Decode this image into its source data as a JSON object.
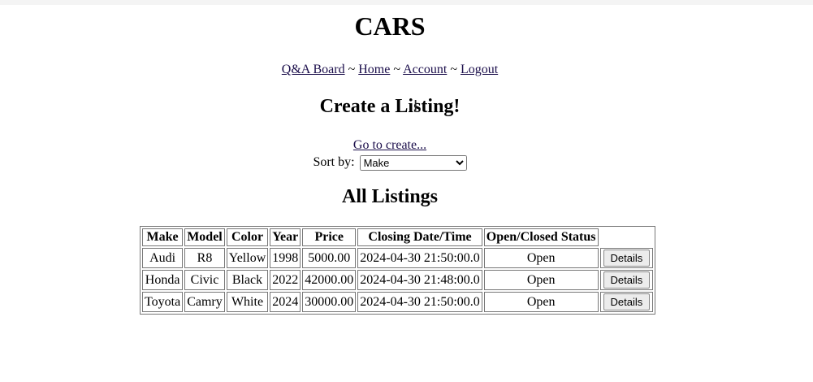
{
  "header": {
    "title": "CARS"
  },
  "nav": {
    "qa_board": "Q&A Board",
    "sep1": "~",
    "home": "Home",
    "sep2": "~",
    "account": "Account",
    "sep3": "~",
    "logout": "Logout"
  },
  "create": {
    "title": "Create a Listing!",
    "link": "Go to create..."
  },
  "sort": {
    "label": "Sort by:",
    "selected": "Make"
  },
  "listings": {
    "title": "All Listings",
    "columns": [
      "Make",
      "Model",
      "Color",
      "Year",
      "Price",
      "Closing Date/Time",
      "Open/Closed Status"
    ],
    "rows": [
      {
        "make": "Audi",
        "model": "R8",
        "color": "Yellow",
        "year": "1998",
        "price": "5000.00",
        "closing": "2024-04-30 21:50:00.0",
        "status": "Open",
        "action": "Details"
      },
      {
        "make": "Honda",
        "model": "Civic",
        "color": "Black",
        "year": "2022",
        "price": "42000.00",
        "closing": "2024-04-30 21:48:00.0",
        "status": "Open",
        "action": "Details"
      },
      {
        "make": "Toyota",
        "model": "Camry",
        "color": "White",
        "year": "2024",
        "price": "30000.00",
        "closing": "2024-04-30 21:50:00.0",
        "status": "Open",
        "action": "Details"
      }
    ]
  },
  "cursor": {
    "icon": "text-cursor-icon",
    "glyph": "I"
  }
}
